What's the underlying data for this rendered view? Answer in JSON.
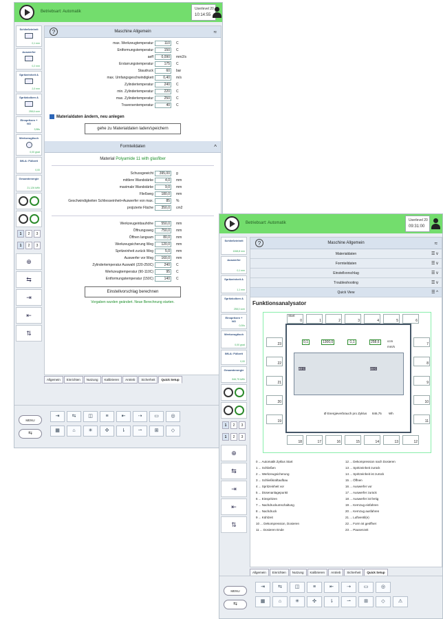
{
  "w1": {
    "mode": "Betriebsart: Automatik",
    "user": "Userlevel 20",
    "time": "10:14:55",
    "sidebar": [
      {
        "h": "Schließeinheit",
        "v": "0,1 mm"
      },
      {
        "h": "Auswerfer",
        "v": "0,2 mm"
      },
      {
        "h": "Spritzeinheit A",
        "v": "2,0 mm"
      },
      {
        "h": "Spritzkolben A",
        "v": "258,6 ccm"
      },
      {
        "h": "Einspritzen + NO",
        "v": "3,58s"
      },
      {
        "h": "Werkzeugtisch",
        "v": "0,00 grad"
      },
      {
        "h": "IMLA: Füllzeit",
        "v": "0,00"
      },
      {
        "h": "Gesamtenergie",
        "v": "21,126 kWh"
      }
    ],
    "nums": [
      "1",
      "2",
      "3"
    ],
    "panel1": {
      "title": "Maschine Allgemein",
      "rows": [
        {
          "l": "max. Werkzeugtemperatur",
          "v": "110",
          "u": "C"
        },
        {
          "l": "Entformungstemperatur",
          "v": "150",
          "u": "C"
        },
        {
          "l": "aeff",
          "v": "0,090",
          "u": "mm2/s"
        },
        {
          "l": "Erstarrungstemperatur",
          "v": "175",
          "u": "C"
        },
        {
          "l": "Staudruck",
          "v": "60",
          "u": "bar"
        },
        {
          "l": "max. Umfangsgeschwindigkeit",
          "v": "0,40",
          "u": "m/s"
        },
        {
          "l": "Zylindertemperatur",
          "v": "240",
          "u": "C"
        },
        {
          "l": "min. Zylindertemperatur",
          "v": "220",
          "u": "C"
        },
        {
          "l": "max. Zylindertemperatur",
          "v": "250",
          "u": "C"
        },
        {
          "l": "Traversentemperatur",
          "v": "40",
          "u": "C"
        }
      ],
      "check": "Materialdaten ändern, neu anlegen",
      "button": "gehe zu Materialdaten laden/speichern"
    },
    "panel2": {
      "title": "Formteildaten",
      "material_label": "Material",
      "material": "Polyamide 11 with glasfiber",
      "rows": [
        {
          "l": "Schussgewicht",
          "v": "395,00",
          "u": "g"
        },
        {
          "l": "mittlere Wandstärke",
          "v": "4,0",
          "u": "mm"
        },
        {
          "l": "maximale Wandstärke",
          "v": "9,0",
          "u": "mm"
        },
        {
          "l": "Fließweg",
          "v": "180,0",
          "u": "mm"
        },
        {
          "l": "Geschwindigkeiten Schliesseinheit+Auswerfer von max.",
          "v": "85",
          "u": "%"
        },
        {
          "l": "projizierte Fläche",
          "v": "350,0",
          "u": "cm2"
        }
      ],
      "rows2": [
        {
          "l": "Werkzeugeinbauhöhe",
          "v": "550,0",
          "u": "mm"
        },
        {
          "l": "Öffnungsweg",
          "v": "750,0",
          "u": "mm"
        },
        {
          "l": "Öffnen langsam",
          "v": "80,0",
          "u": "mm"
        },
        {
          "l": "Werkzeugsicherung Weg",
          "v": "120,0",
          "u": "mm"
        },
        {
          "l": "Spritzeinheit zurück Weg",
          "v": "5,0",
          "u": "mm"
        },
        {
          "l": "Auswerfer vor Weg",
          "v": "160,0",
          "u": "mm"
        },
        {
          "l": "Zylindertemperatur Auswahl (220-250C)",
          "v": "240",
          "u": "C"
        },
        {
          "l": "Werkzeugtemperatur (90-110C)",
          "v": "95",
          "u": "C"
        },
        {
          "l": "Entformungstemperatur (150C)",
          "v": "140",
          "u": "C"
        }
      ],
      "button": "Einstellvorschlag berechnen",
      "status": "Vorgaben wurden geändert. Neue Berechnung starten."
    }
  },
  "tabs": [
    "Allgemein",
    "Einrichten",
    "Nutzung",
    "Kalibrieren",
    "Antrieb",
    "Sicherheit",
    "Quick Setup"
  ],
  "menu": "MENU",
  "w2": {
    "mode": "Betriebsart: Automatik",
    "user": "Userlevel 20",
    "time": "09:31:00",
    "sidebar": [
      {
        "h": "Schließeinheit",
        "v": "1068,8 mm"
      },
      {
        "h": "Auswerfer",
        "v": "0,1 mm"
      },
      {
        "h": "Spritzeinheit A",
        "v": "1,1 mm"
      },
      {
        "h": "Spritzkolben A",
        "v": "258,0 ccm"
      },
      {
        "h": "Einspritzen + NO",
        "v": "0,00s"
      },
      {
        "h": "Werkzeugtisch",
        "v": "0,00 grad"
      },
      {
        "h": "IMLA: Füllzeit",
        "v": "0,00"
      },
      {
        "h": "Gesamtenergie",
        "v": "846,75 kWh"
      }
    ],
    "title": "Maschine Allgemein",
    "acc": [
      "Materialdaten",
      "Formteildaten",
      "Einstellvorschlag",
      "Troubleshooting",
      "Quick View"
    ],
    "func_title": "Funktionsanalysator",
    "diag": {
      "start": "Start",
      "readout": [
        "0,1",
        "1300,0",
        "-1,1",
        "258,6"
      ],
      "u1": "mm",
      "u2": "ccm",
      "u3": "mm/s",
      "t1": "40 C",
      "t2": "24 C",
      "energy": "Ø Energieverbrauch pro Zyklus",
      "energy_v": "846,75",
      "energy_u": "Wh",
      "top": [
        "0",
        "1",
        "2",
        "3",
        "4",
        "5",
        "6"
      ],
      "right": [
        "7",
        "8",
        "9",
        "10",
        "11"
      ],
      "bottom": [
        "18",
        "17",
        "16",
        "15",
        "14",
        "13",
        "12"
      ],
      "left": [
        "23",
        "22",
        "21",
        "20",
        "19"
      ]
    },
    "legend": [
      "0 ... Automatik Zyklus Start",
      "12 ... Dekompression nach Dosieren",
      "1 ... Schließen",
      "13 ... Spritzeinheit zurück",
      "2 ... Werkzeugsicherung",
      "14 ... Spritzeinheit ist zurück",
      "3 ... Schließkraftaufbau",
      "15 ... Öffnen",
      "4 ... Spritzeinheit vor",
      "16 ... Auswerfer vor",
      "5 ... Düsenanlagepunkt",
      "17 ... Auswerfer zurück",
      "6 ... Einspritzen",
      "18 ... Auswerfer ist fertig",
      "7 ... Nachdruckumschaltung",
      "19 ... Kernzug einfahren",
      "8 ... Nachdruck",
      "20 ... Kernzug ausfahren",
      "9 ... Kühlzeit",
      "21 ... Luftventil(e)",
      "10 ... Dekompression, Dosieren",
      "22 ... Form ist geöffnet",
      "11 ... Dosieren Ende",
      "23 ... Pausenzeit"
    ]
  }
}
